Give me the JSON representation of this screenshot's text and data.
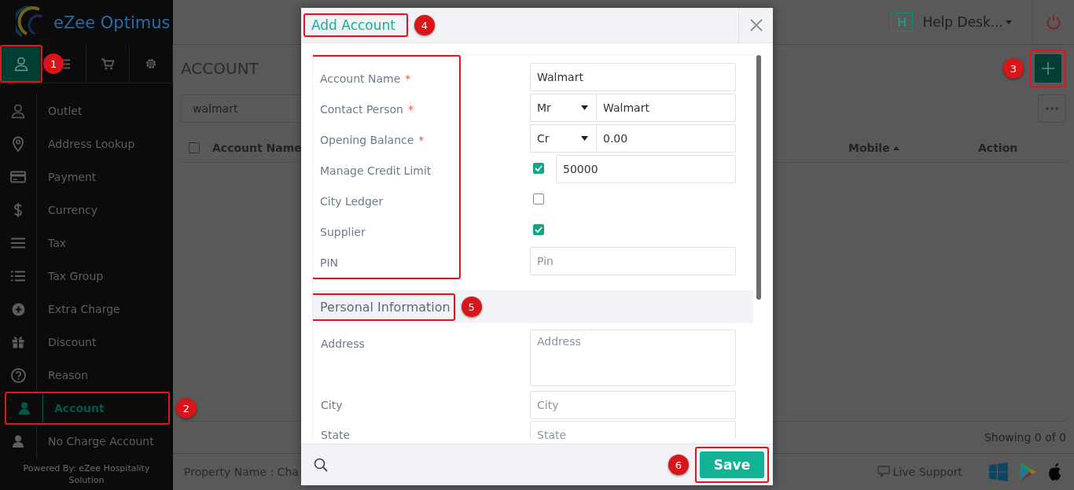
{
  "sidebar": {
    "logo_text": "eZee Optimus",
    "tabs": [
      {
        "selected": true,
        "callout": "1"
      },
      {
        "selected": false
      },
      {
        "selected": false
      },
      {
        "selected": false
      }
    ],
    "items": [
      {
        "label": "Outlet",
        "selected": false
      },
      {
        "label": "Address Lookup",
        "selected": false
      },
      {
        "label": "Payment",
        "selected": false
      },
      {
        "label": "Currency",
        "selected": false
      },
      {
        "label": "Tax",
        "selected": false
      },
      {
        "label": "Tax Group",
        "selected": false
      },
      {
        "label": "Extra Charge",
        "selected": false
      },
      {
        "label": "Discount",
        "selected": false
      },
      {
        "label": "Reason",
        "selected": false
      },
      {
        "label": "Account",
        "selected": true,
        "callout": "2"
      },
      {
        "label": "No Charge Account",
        "selected": false
      }
    ],
    "footer": "Powered By: eZee Hospitality Solution"
  },
  "header": {
    "user_badge": "H",
    "user_name": "Help Desk..."
  },
  "page": {
    "title": "ACCOUNT",
    "add_button": {
      "callout": "3"
    },
    "search_value": "walmart",
    "select_all": {
      "checked": false
    },
    "columns": [
      {
        "label": "Account Name",
        "sorted": false
      },
      {
        "label": "Mobile",
        "sorted": true
      },
      {
        "label": "Action",
        "sorted": false
      }
    ],
    "count": "Showing 0 of 0"
  },
  "footer": {
    "property": "Property Name : Cha",
    "live_support": "Live Support"
  },
  "dialog": {
    "title": {
      "text": "Add Account",
      "callout": "4"
    },
    "label_column": {
      "highlighted": true
    },
    "fields": [
      {
        "kind": "text",
        "label": "Account Name",
        "marker": "*",
        "value": "Walmart"
      },
      {
        "kind": "select_text",
        "label": "Contact Person",
        "marker": "*",
        "option": "Mr",
        "value": "Walmart"
      },
      {
        "kind": "select_text",
        "label": "Opening Balance",
        "marker": "*",
        "option": "Cr",
        "value": "0.00"
      },
      {
        "kind": "check_text",
        "label": "Manage Credit Limit",
        "checked": true,
        "value": "50000"
      },
      {
        "kind": "check",
        "label": "City Ledger",
        "checked": false
      },
      {
        "kind": "check",
        "label": "Supplier",
        "checked": true
      },
      {
        "kind": "text",
        "label": "PIN",
        "placeholder": "Pin"
      }
    ],
    "section": {
      "title": "Personal Information",
      "callout": "5"
    },
    "personal_fields": [
      {
        "kind": "textarea",
        "label": "Address",
        "placeholder": "Address"
      },
      {
        "kind": "text",
        "label": "City",
        "placeholder": "City"
      },
      {
        "kind": "text",
        "label": "State",
        "placeholder": "State"
      }
    ],
    "save_button": {
      "label": "Save",
      "callout": "6"
    }
  }
}
